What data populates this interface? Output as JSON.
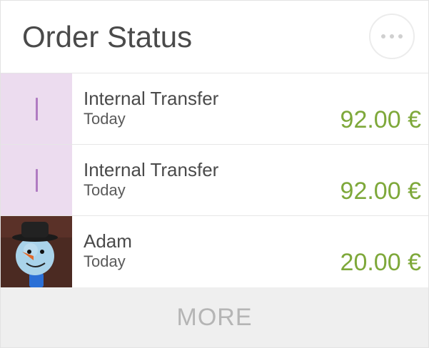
{
  "header": {
    "title": "Order Status",
    "menu_icon": "more-horizontal-icon"
  },
  "colors": {
    "amount": "#7ea83a",
    "thumb_placeholder": "#ecdcef",
    "thumb_bar": "#b07bc2",
    "more_bg": "#efefef"
  },
  "transactions": [
    {
      "title": "Internal Transfer",
      "date": "Today",
      "amount": "92.00 €",
      "thumb": "transfer-placeholder-icon"
    },
    {
      "title": "Internal Transfer",
      "date": "Today",
      "amount": "92.00 €",
      "thumb": "transfer-placeholder-icon"
    },
    {
      "title": "Adam",
      "date": "Today",
      "amount": "20.00 €",
      "thumb": "snowman-avatar"
    }
  ],
  "more_button": {
    "label": "MORE"
  }
}
